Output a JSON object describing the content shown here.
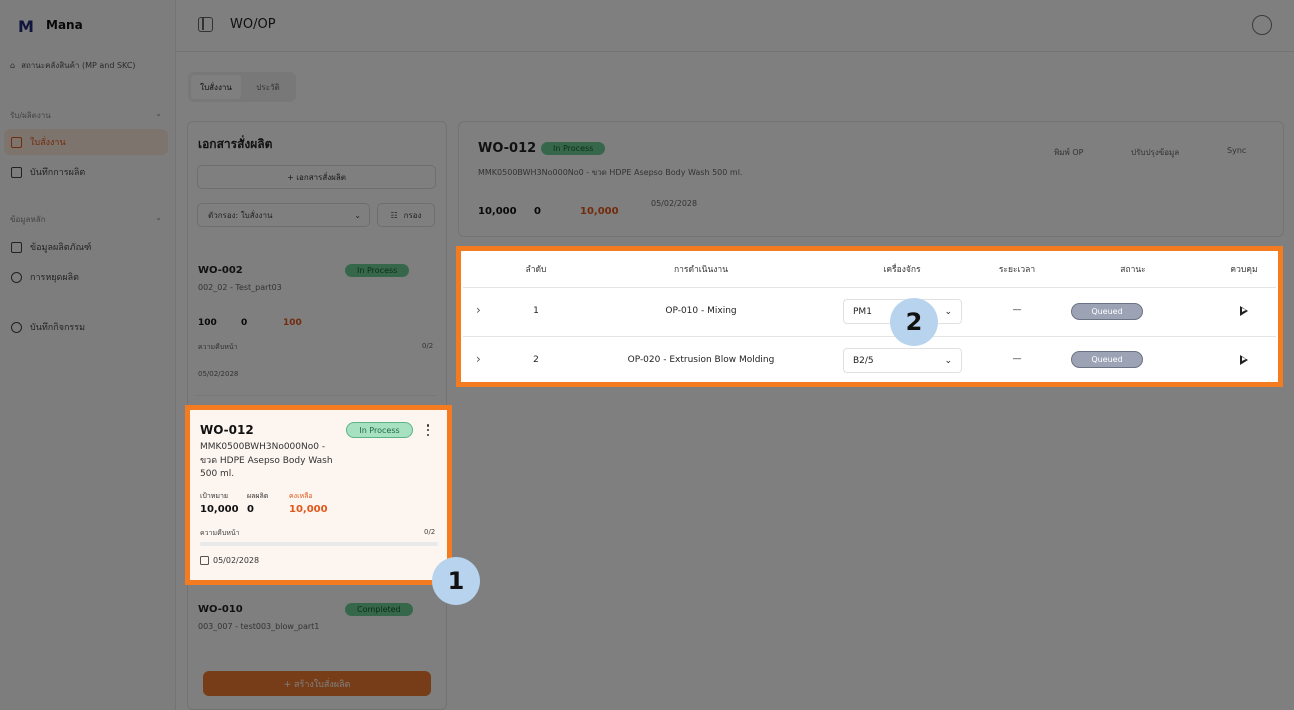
{
  "app": {
    "name": "Mana",
    "org": "สถานะคลังสินค้า (MP and SKC)",
    "page_title": "WO/OP"
  },
  "sidebar": {
    "section1": "รับ/ผลิตงาน",
    "items1": [
      "ใบสั่งงาน",
      "บันทึกการผลิต"
    ],
    "section2": "ข้อมูลหลัก",
    "items2": [
      "ข้อมูลผลิตภัณฑ์",
      "การหยุดผลิต"
    ],
    "items3": [
      "บันทึกกิจกรรม"
    ]
  },
  "tabs": [
    "ใบสั่งงาน",
    "ประวัติ"
  ],
  "wo_list": {
    "title": "เอกสารสั่งผลิต",
    "new_button": "+ เอกสารสั่งผลิต",
    "filter_value": "ตัวกรอง: ใบสั่งงาน",
    "filter_button": "กรอง",
    "create_button": "+ สร้างใบสั่งผลิต"
  },
  "cards": [
    {
      "wo": "WO-002",
      "desc": "002_02 - Test_part03",
      "badge": "In Process",
      "target": "100",
      "produced": "0",
      "remaining": "100",
      "progress_label": "ความคืบหน้า",
      "progress": "0/2",
      "date": "05/02/2028"
    },
    {
      "wo": "WO-010",
      "desc": "003_007 - test003_blow_part1",
      "badge": "Completed"
    }
  ],
  "selected_card": {
    "wo": "WO-012",
    "badge": "In Process",
    "desc": "MMK0500BWH3No000No0 - ขวด HDPE Asepso Body Wash 500 ml.",
    "target_label": "เป้าหมาย",
    "target": "10,000",
    "produced_label": "ผลผลิต",
    "produced": "0",
    "remaining_label": "คงเหลือ",
    "remaining": "10,000",
    "progress_label": "ความคืบหน้า",
    "progress_text": "0/2",
    "progress_fraction": 0,
    "date": "05/02/2028"
  },
  "detail": {
    "wo": "WO-012",
    "badge": "In Process",
    "desc": "MMK0500BWH3No000No0 - ขวด HDPE Asepso Body Wash 500 ml.",
    "target": "10,000",
    "produced": "0",
    "remaining": "10,000",
    "date": "05/02/2028",
    "actions": [
      "พิมพ์ OP",
      "ปรับปรุงข้อมูล",
      "Sync"
    ]
  },
  "op_table": {
    "headers": [
      "ลำดับ",
      "การดำเนินงาน",
      "เครื่องจักร",
      "ระยะเวลา",
      "สถานะ",
      "ควบคุม"
    ],
    "rows": [
      {
        "seq": "1",
        "op": "OP-010 - Mixing",
        "machine": "PM1",
        "duration": "—",
        "status": "Queued"
      },
      {
        "seq": "2",
        "op": "OP-020 - Extrusion Blow Molding",
        "machine": "B2/5",
        "duration": "—",
        "status": "Queued"
      }
    ]
  },
  "markers": [
    "1",
    "2"
  ],
  "colors": {
    "highlight": "#f47b20",
    "accent": "#ef7b32",
    "marker": "#b8d3ee",
    "status_queued": "#9ca3b4",
    "badge_inprocess": "#a8e0c2"
  }
}
